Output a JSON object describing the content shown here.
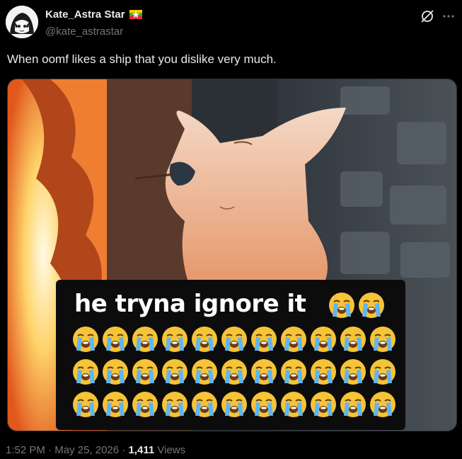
{
  "author": {
    "display_name": "Kate_Astra Star",
    "handle": "@kate_astrastar"
  },
  "tweet": {
    "text": "When oomf likes a ship that you dislike very much."
  },
  "media": {
    "caption": "he tryna ignore it",
    "emoji_name": "loudly-crying-face"
  },
  "footer": {
    "time": "1:52 PM",
    "separator1": " · ",
    "date": "May 25, 2026",
    "separator2": " · ",
    "views_count": "1,411",
    "views_label": " Views"
  },
  "colors": {
    "background": "#000000",
    "text": "#e7e9ea",
    "muted": "#71767b"
  }
}
